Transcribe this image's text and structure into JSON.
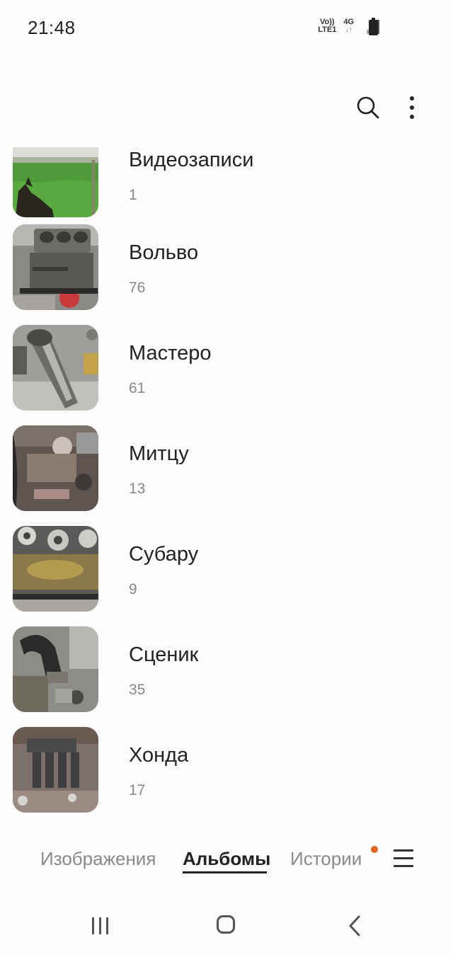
{
  "status_bar": {
    "time": "21:48",
    "volte_top": "Vo))",
    "volte_bottom": "LTE1",
    "network": "4G",
    "network_arrows": "↓↑"
  },
  "toolbar": {
    "search_icon": "search-icon",
    "more_icon": "more-vertical-icon"
  },
  "albums": [
    {
      "name": "Видеозаписи",
      "count": "1"
    },
    {
      "name": "Вольво",
      "count": "76"
    },
    {
      "name": "Мастеро",
      "count": "61"
    },
    {
      "name": "Митцу",
      "count": "13"
    },
    {
      "name": "Субару",
      "count": "9"
    },
    {
      "name": "Сценик",
      "count": "35"
    },
    {
      "name": "Хонда",
      "count": "17"
    }
  ],
  "tabs": [
    {
      "label": "Изображения",
      "active": false
    },
    {
      "label": "Альбомы",
      "active": true
    },
    {
      "label": "Истории",
      "active": false
    }
  ],
  "colors": {
    "notification_dot": "#e8631c",
    "background": "#fcfcfc"
  }
}
